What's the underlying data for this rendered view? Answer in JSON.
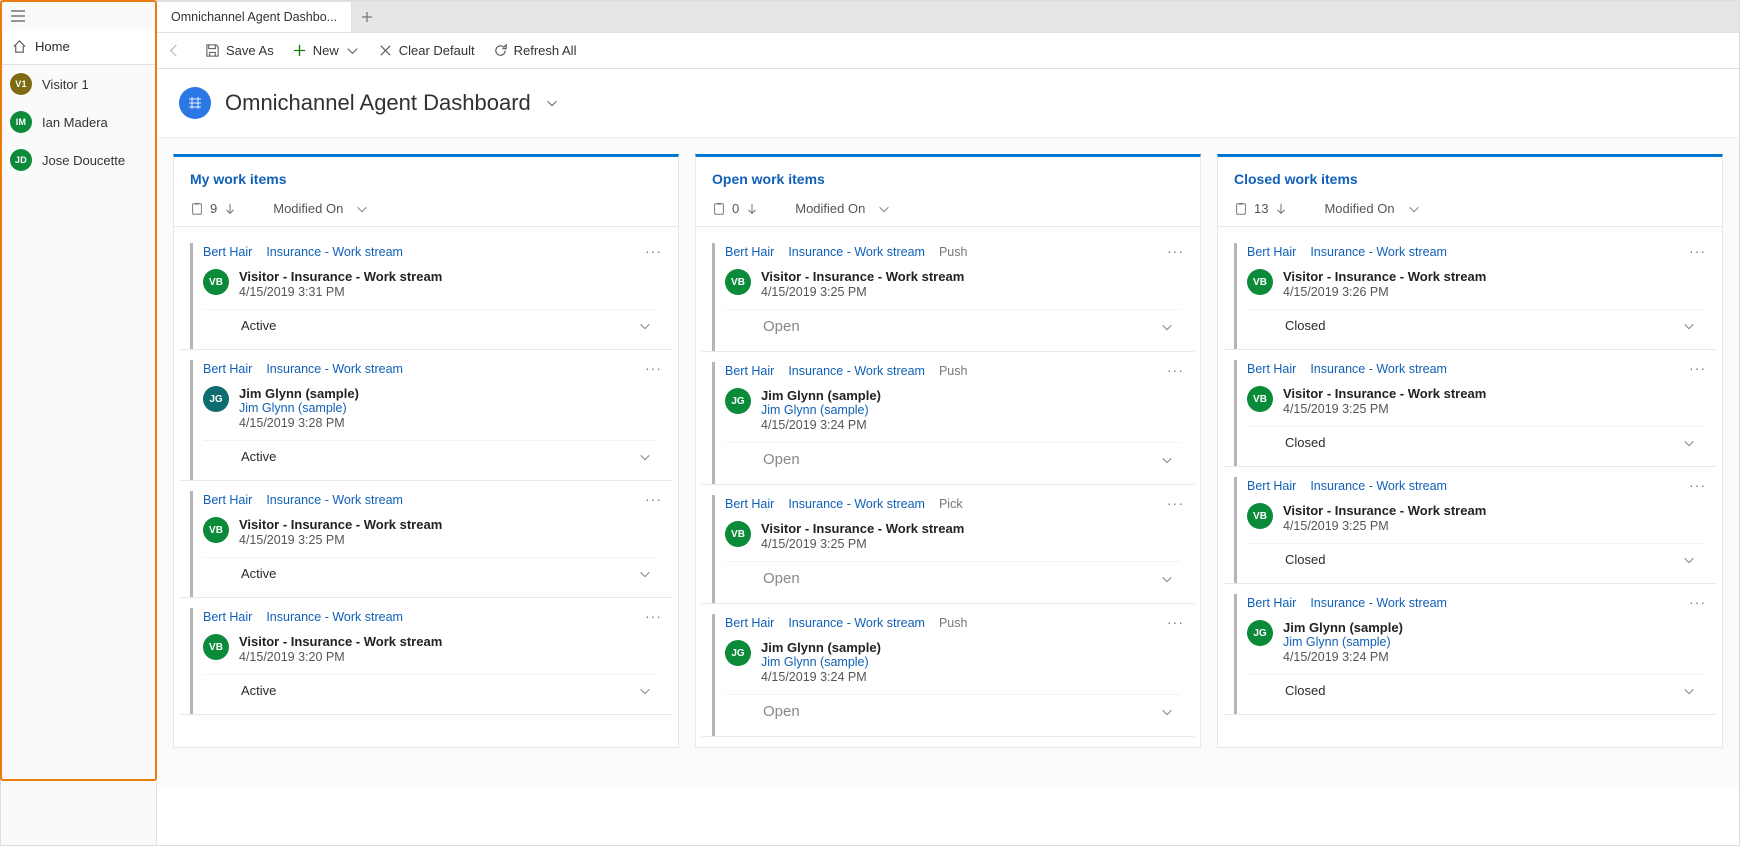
{
  "sidebar": {
    "home_label": "Home",
    "items": [
      {
        "initials": "V1",
        "name": "Visitor 1",
        "color": "#7d6b12"
      },
      {
        "initials": "IM",
        "name": "Ian Madera",
        "color": "#0b8a3a"
      },
      {
        "initials": "JD",
        "name": "Jose Doucette",
        "color": "#0b8a3a"
      }
    ]
  },
  "tabs": {
    "active_label": "Omnichannel Agent Dashbo..."
  },
  "toolbar": {
    "save_as": "Save As",
    "new": "New",
    "clear_default": "Clear Default",
    "refresh_all": "Refresh All"
  },
  "page_title": "Omnichannel Agent Dashboard",
  "columns": [
    {
      "title": "My work items",
      "count": "9",
      "sort": "Modified On",
      "cards": [
        {
          "owner": "Bert Hair",
          "stream": "Insurance - Work stream",
          "tag": "",
          "avatar": "VB",
          "avColor": "#0b8a3a",
          "title": "Visitor - Insurance - Work stream",
          "link": "",
          "time": "4/15/2019 3:31 PM",
          "status": "Active",
          "open": false
        },
        {
          "owner": "Bert Hair",
          "stream": "Insurance - Work stream",
          "tag": "",
          "avatar": "JG",
          "avColor": "#0e6b6f",
          "title": "Jim Glynn (sample)",
          "link": "Jim Glynn (sample)",
          "time": "4/15/2019 3:28 PM",
          "status": "Active",
          "open": false
        },
        {
          "owner": "Bert Hair",
          "stream": "Insurance - Work stream",
          "tag": "",
          "avatar": "VB",
          "avColor": "#0b8a3a",
          "title": "Visitor - Insurance - Work stream",
          "link": "",
          "time": "4/15/2019 3:25 PM",
          "status": "Active",
          "open": false
        },
        {
          "owner": "Bert Hair",
          "stream": "Insurance - Work stream",
          "tag": "",
          "avatar": "VB",
          "avColor": "#0b8a3a",
          "title": "Visitor - Insurance - Work stream",
          "link": "",
          "time": "4/15/2019 3:20 PM",
          "status": "Active",
          "open": false
        }
      ]
    },
    {
      "title": "Open work items",
      "count": "0",
      "sort": "Modified On",
      "cards": [
        {
          "owner": "Bert Hair",
          "stream": "Insurance - Work stream",
          "tag": "Push",
          "avatar": "VB",
          "avColor": "#0b8a3a",
          "title": "Visitor - Insurance - Work stream",
          "link": "",
          "time": "4/15/2019 3:25 PM",
          "status": "Open",
          "open": true
        },
        {
          "owner": "Bert Hair",
          "stream": "Insurance - Work stream",
          "tag": "Push",
          "avatar": "JG",
          "avColor": "#0b8a3a",
          "title": "Jim Glynn (sample)",
          "link": "Jim Glynn (sample)",
          "time": "4/15/2019 3:24 PM",
          "status": "Open",
          "open": true
        },
        {
          "owner": "Bert Hair",
          "stream": "Insurance - Work stream",
          "tag": "Pick",
          "avatar": "VB",
          "avColor": "#0b8a3a",
          "title": "Visitor - Insurance - Work stream",
          "link": "",
          "time": "4/15/2019 3:25 PM",
          "status": "Open",
          "open": true
        },
        {
          "owner": "Bert Hair",
          "stream": "Insurance - Work stream",
          "tag": "Push",
          "avatar": "JG",
          "avColor": "#0b8a3a",
          "title": "Jim Glynn (sample)",
          "link": "Jim Glynn (sample)",
          "time": "4/15/2019 3:24 PM",
          "status": "Open",
          "open": true
        }
      ]
    },
    {
      "title": "Closed work items",
      "count": "13",
      "sort": "Modified On",
      "cards": [
        {
          "owner": "Bert Hair",
          "stream": "Insurance - Work stream",
          "tag": "",
          "avatar": "VB",
          "avColor": "#0b8a3a",
          "title": "Visitor - Insurance - Work stream",
          "link": "",
          "time": "4/15/2019 3:26 PM",
          "status": "Closed",
          "open": false
        },
        {
          "owner": "Bert Hair",
          "stream": "Insurance - Work stream",
          "tag": "",
          "avatar": "VB",
          "avColor": "#0b8a3a",
          "title": "Visitor - Insurance - Work stream",
          "link": "",
          "time": "4/15/2019 3:25 PM",
          "status": "Closed",
          "open": false
        },
        {
          "owner": "Bert Hair",
          "stream": "Insurance - Work stream",
          "tag": "",
          "avatar": "VB",
          "avColor": "#0b8a3a",
          "title": "Visitor - Insurance - Work stream",
          "link": "",
          "time": "4/15/2019 3:25 PM",
          "status": "Closed",
          "open": false
        },
        {
          "owner": "Bert Hair",
          "stream": "Insurance - Work stream",
          "tag": "",
          "avatar": "JG",
          "avColor": "#0b8a3a",
          "title": "Jim Glynn (sample)",
          "link": "Jim Glynn (sample)",
          "time": "4/15/2019 3:24 PM",
          "status": "Closed",
          "open": false
        }
      ]
    }
  ]
}
